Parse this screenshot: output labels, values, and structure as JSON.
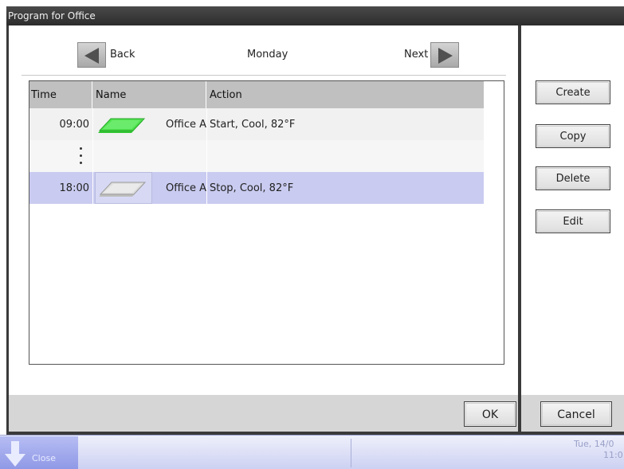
{
  "window": {
    "title": "Program for Office"
  },
  "nav": {
    "back_label": "Back",
    "day": "Monday",
    "next_label": "Next"
  },
  "table": {
    "headers": [
      "Time",
      "Name",
      "Action"
    ],
    "rows": [
      {
        "time": "09:00",
        "name": "Office A",
        "action": "Start, Cool, 82°F",
        "icon": "unit-on-icon"
      },
      {
        "time": "",
        "name": "",
        "action": "",
        "icon": "ellipsis-icon"
      },
      {
        "time": "18:00",
        "name": "Office A",
        "action": "Stop, Cool, 82°F",
        "icon": "unit-off-icon"
      }
    ]
  },
  "side": {
    "create_label": "Create",
    "copy_label": "Copy",
    "delete_label": "Delete",
    "edit_label": "Edit"
  },
  "footer": {
    "ok_label": "OK",
    "cancel_label": "Cancel"
  },
  "taskbar": {
    "close_label": "Close",
    "date": "Tue, 14/0",
    "time": "11:0"
  },
  "colors": {
    "selected_row": "#c9cbf0",
    "on_unit": "#3fdc3f",
    "taskbar": "#cdd1f2"
  }
}
